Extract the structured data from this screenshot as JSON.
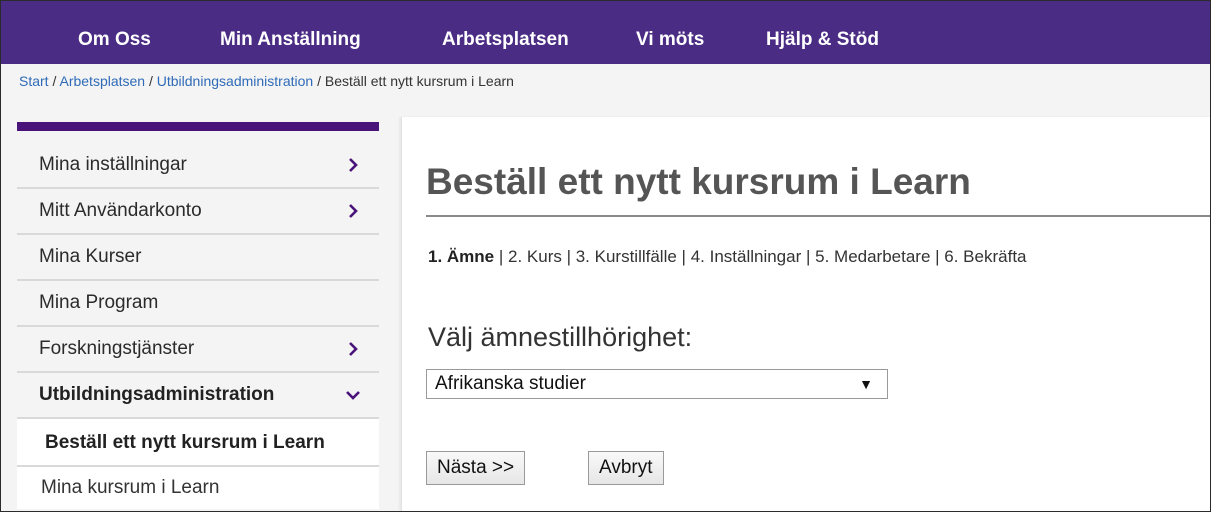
{
  "topnav": {
    "items": [
      "Om Oss",
      "Min Anställning",
      "Arbetsplatsen",
      "Vi möts",
      "Hjälp & Stöd"
    ],
    "bg_color": "#4a2c84"
  },
  "breadcrumb": {
    "links": [
      "Start",
      "Arbetsplatsen",
      "Utbildningsadministration"
    ],
    "separator": "/",
    "current": "Beställ ett nytt kursrum i Learn"
  },
  "sidebar": {
    "accent_color": "#4a137a",
    "items": [
      {
        "label": "Mina inställningar",
        "icon": "chevron-right-icon"
      },
      {
        "label": "Mitt Användarkonto",
        "icon": "chevron-right-icon"
      },
      {
        "label": "Mina Kurser",
        "icon": ""
      },
      {
        "label": "Mina Program",
        "icon": ""
      },
      {
        "label": "Forskningstjänster",
        "icon": "chevron-right-icon"
      },
      {
        "label": "Utbildningsadministration",
        "icon": "chevron-down-icon"
      }
    ],
    "sub_active": "Beställ ett nytt kursrum i Learn",
    "sub_next": "Mina kursrum i Learn"
  },
  "main": {
    "title": "Beställ ett nytt kursrum i Learn",
    "steps": {
      "current": "1. Ämne",
      "rest": [
        " | 2. Kurs",
        " | 3. Kurstillfälle",
        " | 4. Inställningar",
        " | 5. Medarbetare",
        " | 6. Bekräfta"
      ]
    },
    "select_label": "Välj ämnestillhörighet:",
    "select_value": "Afrikanska studier",
    "next_button": "Nästa >>",
    "cancel_button": "Avbryt"
  }
}
